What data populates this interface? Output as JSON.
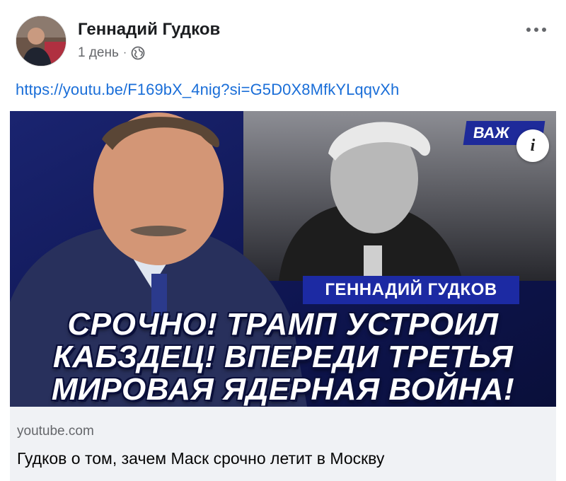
{
  "post": {
    "author": "Геннадий Гудков",
    "time": "1 день",
    "separator": "·",
    "link_text": "https://youtu.be/F169bX_4nig?si=G5D0X8MfkYLqqvXh",
    "privacy_icon": "globe-icon",
    "menu_icon": "more-horizontal-icon"
  },
  "thumbnail": {
    "badge": "ВАЖ",
    "info_label": "i",
    "speaker": "ГЕННАДИЙ ГУДКОВ",
    "headline_lines": [
      "СРОЧНО! ТРАМП УСТРОИЛ",
      "КАБЗДЕЦ! ВПЕРЕДИ ТРЕТЬЯ",
      "МИРОВАЯ ЯДЕРНАЯ ВОЙНА!"
    ]
  },
  "link_preview": {
    "domain": "youtube.com",
    "title": "Гудков о том, зачем Маск срочно летит в Москву"
  },
  "colors": {
    "link": "#1a6ed8",
    "secondary_text": "#65676b",
    "banner_blue": "#1c2aa3",
    "footer_bg": "#f0f2f5"
  }
}
